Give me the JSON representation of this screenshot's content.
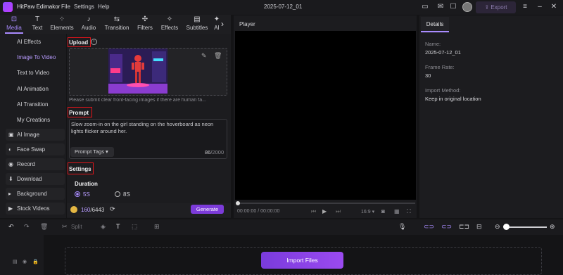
{
  "app": {
    "name": "HitPaw Edimakor",
    "doc_title": "2025-07-12_01"
  },
  "menu": [
    "File",
    "Settings",
    "Help"
  ],
  "header": {
    "export_label": "Export"
  },
  "toolbar": {
    "tabs": [
      {
        "label": "Media",
        "icon": "media-icon"
      },
      {
        "label": "Text",
        "icon": "text-icon"
      },
      {
        "label": "Elements",
        "icon": "elements-icon"
      },
      {
        "label": "Audio",
        "icon": "audio-icon"
      },
      {
        "label": "Transition",
        "icon": "transition-icon"
      },
      {
        "label": "Filters",
        "icon": "filters-icon"
      },
      {
        "label": "Effects",
        "icon": "effects-icon"
      },
      {
        "label": "Subtitles",
        "icon": "subtitles-icon"
      },
      {
        "label": "AI",
        "icon": "ai-icon"
      }
    ]
  },
  "sidebar": {
    "items": [
      "AI Effects",
      "Image To Video",
      "Text to Video",
      "AI Animation",
      "AI Transition",
      "My Creations"
    ],
    "buttons": [
      "AI Image",
      "Face Swap",
      "Record",
      "Download",
      "Background",
      "Stock Videos"
    ]
  },
  "upload": {
    "label": "Upload",
    "hint": "Please submit clear front-facing images if there are human fa..."
  },
  "prompt": {
    "label": "Prompt",
    "text": "Slow zoom-in on the girl standing on the hoverboard as neon lights flicker around her.",
    "tags_label": "Prompt Tags",
    "count": "86",
    "max": "/2000"
  },
  "settings": {
    "label": "Settings",
    "duration_label": "Duration",
    "options": [
      "5S",
      "8S"
    ],
    "selected": "5S"
  },
  "credits": {
    "used": "160",
    "total": "/6443",
    "generate_label": "Generate"
  },
  "player": {
    "title": "Player",
    "current": "00:00:00",
    "separator": "/",
    "duration": "00:00:00",
    "ratio": "16:9"
  },
  "details": {
    "tab": "Details",
    "name_label": "Name:",
    "name_value": "2025-07-12_01",
    "fps_label": "Frame Rate:",
    "fps_value": "30",
    "import_label": "Import Method:",
    "import_value": "Keep in original location"
  },
  "timeline": {
    "split_label": "Split",
    "import_label": "Import Files"
  },
  "colors": {
    "accent": "#a98bff",
    "highlight": "#e0141a",
    "generate": "#7c3bd9"
  }
}
